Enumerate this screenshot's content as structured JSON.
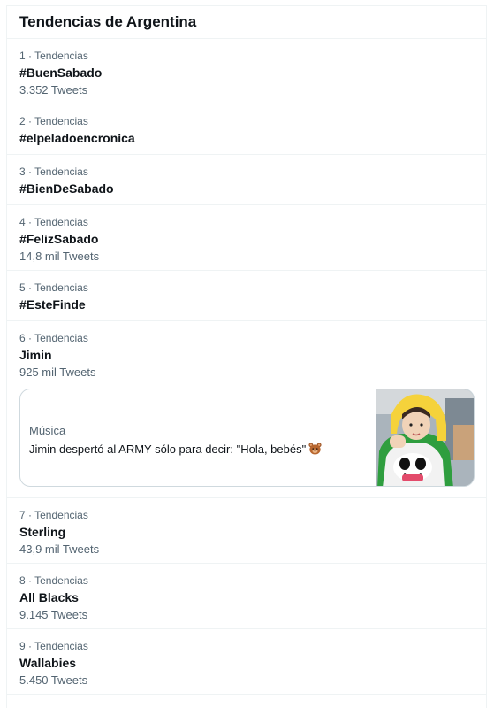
{
  "header": {
    "title": "Tendencias de Argentina"
  },
  "trends": [
    {
      "meta": "1 · Tendencias",
      "name": "#BuenSabado",
      "count": "3.352 Tweets"
    },
    {
      "meta": "2 · Tendencias",
      "name": "#elpeladoencronica",
      "count": ""
    },
    {
      "meta": "3 · Tendencias",
      "name": "#BienDeSabado",
      "count": ""
    },
    {
      "meta": "4 · Tendencias",
      "name": "#FelizSabado",
      "count": "14,8 mil Tweets"
    },
    {
      "meta": "5 · Tendencias",
      "name": "#EsteFinde",
      "count": ""
    },
    {
      "meta": "6 · Tendencias",
      "name": "Jimin",
      "count": "925 mil Tweets"
    },
    {
      "meta": "7 · Tendencias",
      "name": "Sterling",
      "count": "43,9 mil Tweets"
    },
    {
      "meta": "8 · Tendencias",
      "name": "All Blacks",
      "count": "9.145 Tweets"
    },
    {
      "meta": "9 · Tendencias",
      "name": "Wallabies",
      "count": "5.450 Tweets"
    }
  ],
  "card": {
    "category": "Música",
    "headline": "Jimin despertó al ARMY sólo para decir: \"Hola, bebés\"",
    "emoji_icon": "bear-face-icon",
    "thumbnail_icon": "jimin-photo-thumbnail"
  }
}
